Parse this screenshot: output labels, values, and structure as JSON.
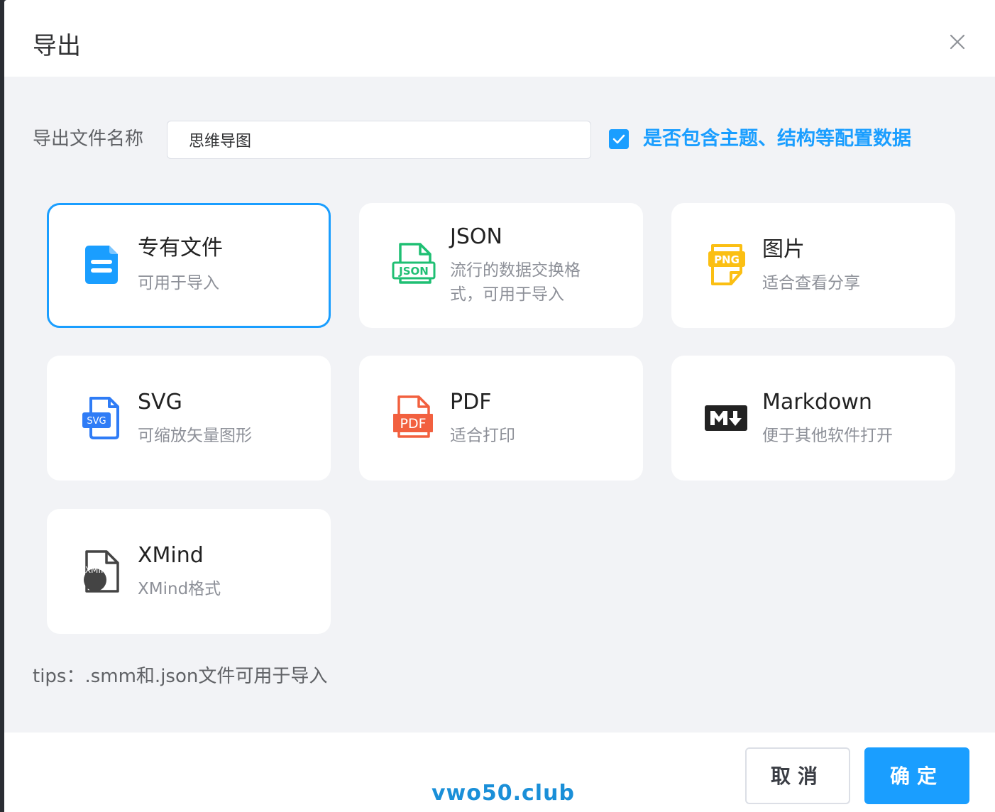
{
  "dialog": {
    "title": "导出",
    "close_icon": "close-icon"
  },
  "form": {
    "filename_label": "导出文件名称",
    "filename_value": "思维导图",
    "include_config_checked": true,
    "include_config_label": "是否包含主题、结构等配置数据"
  },
  "formats": [
    {
      "title": "专有文件",
      "desc": "可用于导入",
      "icon": "smm-file-icon",
      "selected": true,
      "color": "#1a9eff"
    },
    {
      "title": "JSON",
      "desc": "流行的数据交换格式，可用于导入",
      "icon": "json-file-icon",
      "selected": false,
      "color": "#1fbf73"
    },
    {
      "title": "图片",
      "desc": "适合查看分享",
      "icon": "png-file-icon",
      "selected": false,
      "color": "#fbbf13"
    },
    {
      "title": "SVG",
      "desc": "可缩放矢量图形",
      "icon": "svg-file-icon",
      "selected": false,
      "color": "#2f7cf6"
    },
    {
      "title": "PDF",
      "desc": "适合打印",
      "icon": "pdf-file-icon",
      "selected": false,
      "color": "#f2603f"
    },
    {
      "title": "Markdown",
      "desc": "便于其他软件打开",
      "icon": "markdown-icon",
      "selected": false,
      "color": "#222222"
    },
    {
      "title": "XMind",
      "desc": "XMind格式",
      "icon": "xmind-file-icon",
      "selected": false,
      "color": "#444444"
    }
  ],
  "icon_text": {
    "json": "JSON",
    "png": "PNG",
    "svg": "SVG",
    "pdf": "PDF",
    "xmind": "XMIND"
  },
  "tips": "tips：.smm和.json文件可用于导入",
  "buttons": {
    "cancel": "取消",
    "ok": "确定"
  },
  "watermark": "vwo50.club"
}
